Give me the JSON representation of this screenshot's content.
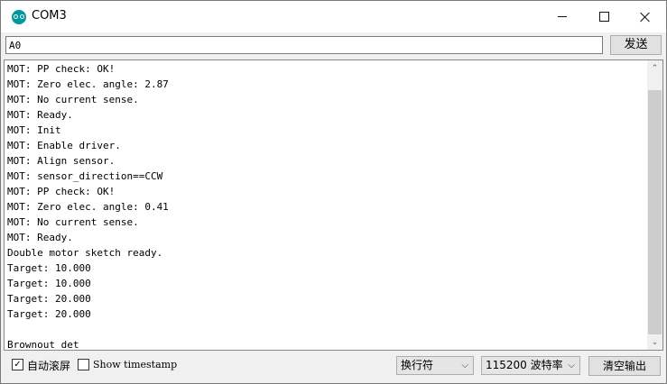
{
  "window": {
    "title": "COM3"
  },
  "send": {
    "input_value": "A0",
    "button_label": "发送"
  },
  "output": {
    "lines": [
      "MOT: PP check: OK!",
      "MOT: Zero elec. angle: 2.87",
      "MOT: No current sense.",
      "MOT: Ready.",
      "MOT: Init",
      "MOT: Enable driver.",
      "MOT: Align sensor.",
      "MOT: sensor_direction==CCW",
      "MOT: PP check: OK!",
      "MOT: Zero elec. angle: 0.41",
      "MOT: No current sense.",
      "MOT: Ready.",
      "Double motor sketch ready.",
      "Target: 10.000",
      "Target: 10.000",
      "Target: 20.000",
      "Target: 20.000",
      "",
      "Brownout det"
    ]
  },
  "bottom": {
    "autoscroll_label": "自动滚屏",
    "autoscroll_checked": "✓",
    "timestamp_label": "Show timestamp",
    "line_ending": "换行符",
    "baud_rate": "115200 波特率",
    "clear_label": "清空输出"
  },
  "icons": {
    "app": "arduino-icon",
    "dropdown": "chevron-down-icon"
  },
  "colors": {
    "accent": "#00979d"
  }
}
